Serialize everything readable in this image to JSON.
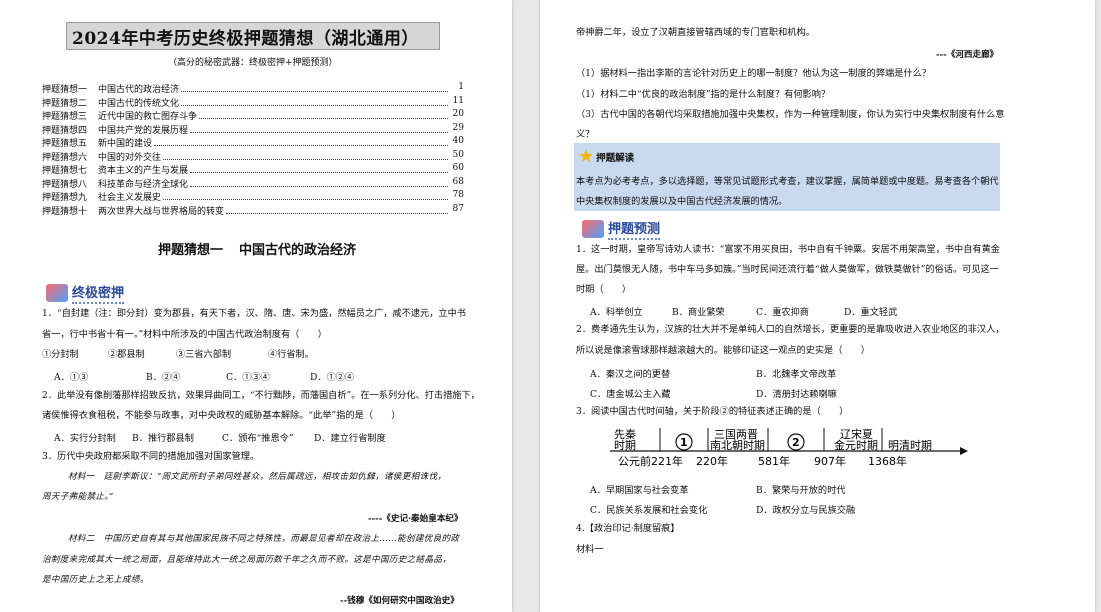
{
  "left_page": {
    "title": "2024年中考历史终极押题猜想（湖北通用）",
    "subtitle": "（高分的秘密武器：终极密押+押题预测）",
    "toc": [
      {
        "num": "押题猜想一",
        "title": "中国古代的政治经济",
        "page": "1"
      },
      {
        "num": "押题猜想二",
        "title": "中国古代的传统文化",
        "page": "11"
      },
      {
        "num": "押题猜想三",
        "title": "近代中国的救亡图存斗争",
        "page": "20"
      },
      {
        "num": "押题猜想四",
        "title": "中国共产党的发展历程",
        "page": "29"
      },
      {
        "num": "押题猜想五",
        "title": "新中国的建设",
        "page": "40"
      },
      {
        "num": "押题猜想六",
        "title": "中国的对外交往",
        "page": "50"
      },
      {
        "num": "押题猜想七",
        "title": "资本主义的产生与发展",
        "page": "60"
      },
      {
        "num": "押题猜想八",
        "title": "科技革命与经济全球化",
        "page": "68"
      },
      {
        "num": "押题猜想九",
        "title": "社会主义发展史",
        "page": "78"
      },
      {
        "num": "押题猜想十",
        "title": "两次世界大战与世界格局的转变",
        "page": "87"
      }
    ],
    "section_title_a": "押题猜想一",
    "section_title_b": "中国古代的政治经济",
    "badge": "终极密押",
    "q1_line1": "1．“自封建（注：即分封）变为郡县，有天下者，汉、隋、唐、宋为盛，然幅员之广，咸不逮元，立中书",
    "q1_line2": "省一，行中书省十有一。”材料中所涉及的中国古代政治制度有（　　）",
    "q1_items": [
      "①分封制",
      "②郡县制",
      "③三省六部制",
      "④行省制。"
    ],
    "q1_opts": [
      "A．①③",
      "B．②④",
      "C．①③④",
      "D．①②④"
    ],
    "q2_line1": "2．此举没有像削藩那样招致反抗，效果异曲同工，“不行黜陟，而藩国自析”。在一系列分化、打击措施下，",
    "q2_line2": "诸侯惟得衣食租税，不能参与政事，对中央政权的威胁基本解除。“此举”指的是（　　）",
    "q2_opts": [
      "A．实行分封制",
      "B．推行郡县制",
      "C．颁布“推恩令”",
      "D．建立行省制度"
    ],
    "q3_line1": "3．历代中央政府都采取不同的措施加强对国家管理。",
    "q3_mat1_a": "材料一　廷尉李斯议：“周文武所封子弟同姓甚众，然后属疏远，相攻击如仇雠，诸侯更相诛伐，",
    "q3_mat1_b": "周天子弗能禁止。”",
    "q3_src1": "----《史记·秦始皇本纪》",
    "q3_mat2_a": "材料二　中国历史自有其与其他国家民族不同之特殊性，而最显见者却在政治上……能创建优良的政",
    "q3_mat2_b": "治制度来完成其大一统之局面，且能维持此大一统之局面历数千年之久而不败。这是中国历史之結晶品，",
    "q3_mat2_c": "是中国历史上之无上成绩。",
    "q3_src2": "--钱穆《如何研究中国政治史》"
  },
  "right_page": {
    "cont_line": "帝神爵二年，设立了汉朝直接管辖西域的专门官职和机构。",
    "cont_src": "---《河西走廊》",
    "sq1": "（1）据材料一指出李斯的言论针对历史上的哪一制度？他认为这一制度的弊端是什么？",
    "sq2": "（1）材料二中“优良的政治制度”指的是什么制度？有何影响？",
    "sq3_a": "（3）古代中国的各朝代均采取措施加强中央集权，作为一种管理制度，你认为实行中央集权制度有什么意",
    "sq3_b": "义？",
    "hl_title": "押题解读",
    "hl_line1": "本考点为必考考点，多以选择题，等常见试题形式考查，建议掌握，属简单题或中度题。易考查各个朝代",
    "hl_line2": "中央集权制度的发展以及中国古代经济发展的情况。",
    "badge": "押题预测",
    "p1_line1": "1．这一时期，皇帝写诗劝人读书：“富家不用买良田，书中自有千钟粟。安居不用架高堂，书中自有黄金",
    "p1_line2": "屋。出门莫恨无人随，书中车马多如簇。”当时民间还流行着“做人莫做军，做铁莫做针”的俗话。可见这一",
    "p1_line3": "时期（　　）",
    "p1_opts": [
      "A．科举创立",
      "B．商业繁荣",
      "C．重农抑商",
      "D．重文轻武"
    ],
    "p2_line1": "2．费孝通先生认为，汉族的壮大并不是单纯人口的自然增长，更重要的是靠吸收进入农业地区的非汉人，",
    "p2_line2": "所以说是像滚雪球那样越滚越大的。能够印证这一观点的史实是（　　）",
    "p2_opts": [
      "A．秦汉之间的更替",
      "B．北魏孝文帝改革",
      "C．唐金城公主入藏",
      "D．清册封达赖喇嘛"
    ],
    "p3_line": "3．阅读中国古代时间轴，关于阶段②的特征表述正确的是（　　）",
    "timeline": {
      "periods": [
        "先秦",
        "时期",
        "①",
        "三国两晋",
        "南北朝时期",
        "②",
        "辽宋夏",
        "金元时期",
        "明清时期"
      ],
      "years": [
        "公元前221年",
        "220年",
        "581年",
        "907年",
        "1368年"
      ]
    },
    "p3_opts": [
      "A．早期国家与社会变革",
      "B．繁荣与开放的时代",
      "C．民族关系发展和社会变化",
      "D．政权分立与民族交融"
    ],
    "p4_line": "4.【政治印记·制度留痕】",
    "p4_mat": "材料一"
  }
}
